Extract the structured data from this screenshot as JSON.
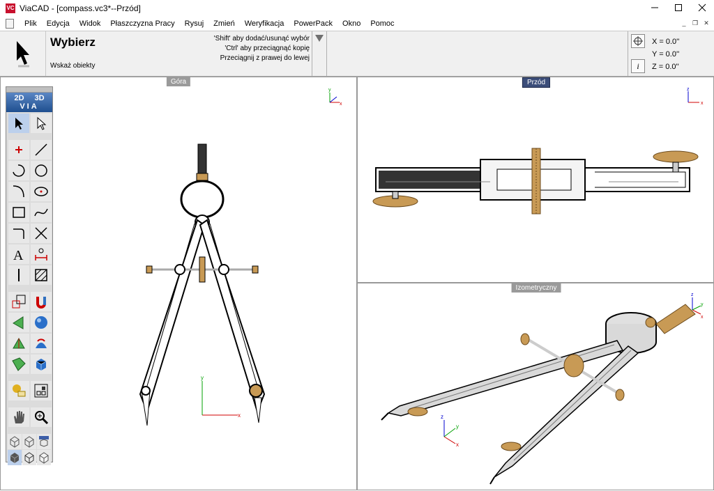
{
  "window": {
    "title": "ViaCAD - [compass.vc3*--Przód]",
    "logo": "VC",
    "controls": [
      "minimize-icon",
      "maximize-icon",
      "close-icon"
    ]
  },
  "menu": [
    "Plik",
    "Edycja",
    "Widok",
    "Płaszczyzna Pracy",
    "Rysuj",
    "Zmień",
    "Weryfikacja",
    "PowerPack",
    "Okno",
    "Pomoc"
  ],
  "tool": {
    "name": "Wybierz",
    "prompt": "Wskaż obiekty",
    "hints": [
      "'Shift' aby dodać/usunąć wybór",
      "'Ctrl' aby przeciągnąć kopię",
      "Przeciągnij z prawej do lewej"
    ]
  },
  "coords": {
    "x": "X = 0.0''",
    "y": "Y = 0.0''",
    "z": "Z = 0.0''",
    "info_label": "i"
  },
  "viewports": {
    "top": "Góra",
    "front": "Przód",
    "iso": "Izometryczny"
  },
  "palette": {
    "label_2d": "2D",
    "label_3d": "3D",
    "label_via": "VIA"
  },
  "axis": {
    "x": "x",
    "y": "y",
    "z": "z"
  },
  "colors": {
    "accent": "#3c4e7a",
    "brass": "#c89a55",
    "steel": "#d9d9d9",
    "x_axis": "#d00000",
    "y_axis": "#00a000",
    "z_axis": "#0000d0"
  }
}
